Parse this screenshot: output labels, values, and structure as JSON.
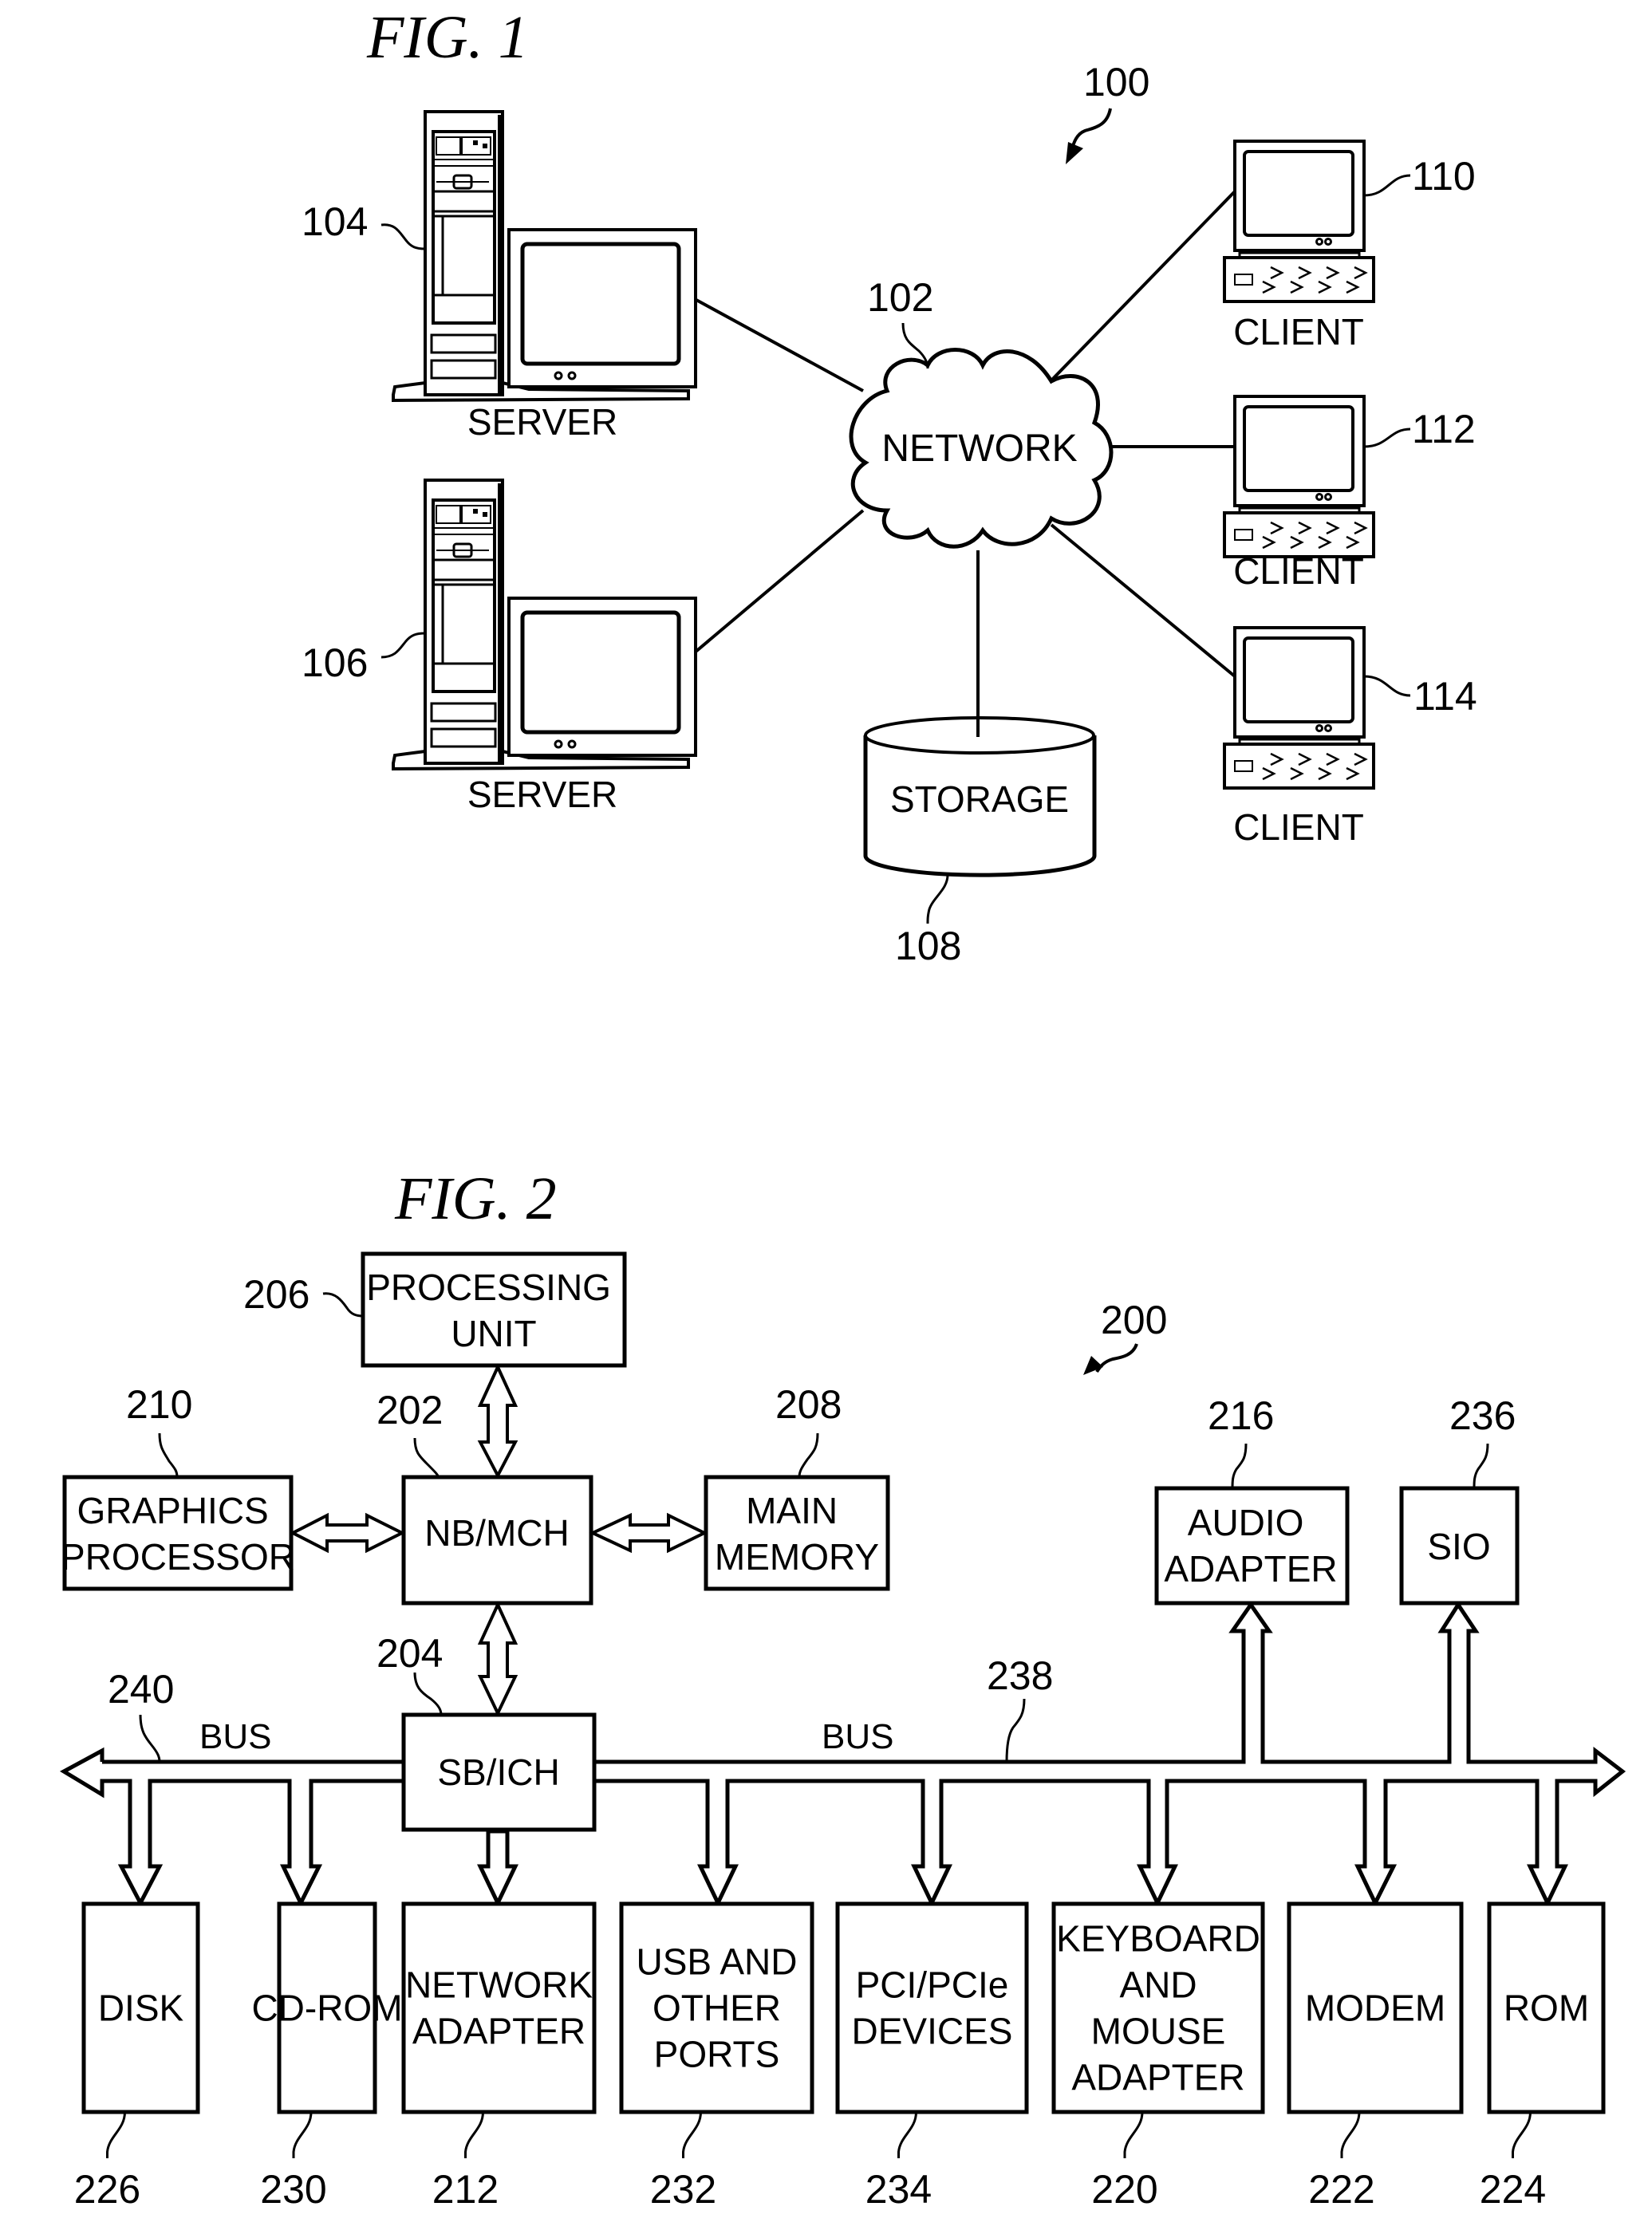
{
  "fig1": {
    "title": "FIG. 1",
    "ref": "100",
    "network": {
      "label": "NETWORK",
      "ref": "102"
    },
    "servers": [
      {
        "label": "SERVER",
        "ref": "104"
      },
      {
        "label": "SERVER",
        "ref": "106"
      }
    ],
    "storage": {
      "label": "STORAGE",
      "ref": "108"
    },
    "clients": [
      {
        "label": "CLIENT",
        "ref": "110"
      },
      {
        "label": "CLIENT",
        "ref": "112"
      },
      {
        "label": "CLIENT",
        "ref": "114"
      }
    ]
  },
  "fig2": {
    "title": "FIG. 2",
    "ref": "200",
    "processing_unit": {
      "lines": [
        "PROCESSING",
        "UNIT"
      ],
      "ref": "206"
    },
    "nb_mch": {
      "lines": [
        "NB/MCH"
      ],
      "ref": "202"
    },
    "graphics": {
      "lines": [
        "GRAPHICS",
        "PROCESSOR"
      ],
      "ref": "210"
    },
    "main_memory": {
      "lines": [
        "MAIN",
        "MEMORY"
      ],
      "ref": "208"
    },
    "sb_ich": {
      "lines": [
        "SB/ICH"
      ],
      "ref": "204"
    },
    "audio": {
      "lines": [
        "AUDIO",
        "ADAPTER"
      ],
      "ref": "216"
    },
    "sio": {
      "lines": [
        "SIO"
      ],
      "ref": "236"
    },
    "bus_left": {
      "label": "BUS",
      "ref": "240"
    },
    "bus_right": {
      "label": "BUS",
      "ref": "238"
    },
    "devices": [
      {
        "lines": [
          "DISK"
        ],
        "ref": "226"
      },
      {
        "lines": [
          "CD-ROM"
        ],
        "ref": "230"
      },
      {
        "lines": [
          "NETWORK",
          "ADAPTER"
        ],
        "ref": "212"
      },
      {
        "lines": [
          "USB AND",
          "OTHER",
          "PORTS"
        ],
        "ref": "232"
      },
      {
        "lines": [
          "PCI/PCIe",
          "DEVICES"
        ],
        "ref": "234"
      },
      {
        "lines": [
          "KEYBOARD",
          "AND",
          "MOUSE",
          "ADAPTER"
        ],
        "ref": "220"
      },
      {
        "lines": [
          "MODEM"
        ],
        "ref": "222"
      },
      {
        "lines": [
          "ROM"
        ],
        "ref": "224"
      }
    ]
  }
}
